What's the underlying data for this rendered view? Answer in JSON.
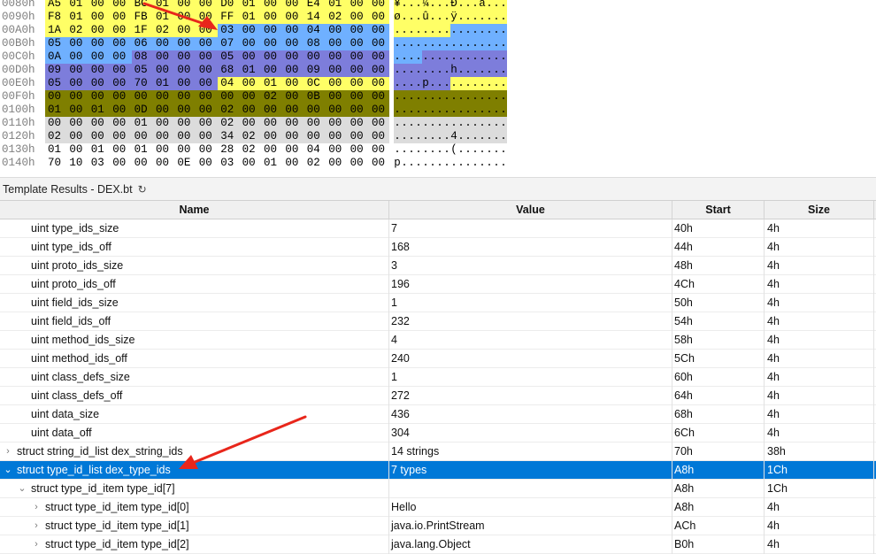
{
  "hex": {
    "colors": {
      "yellow": "#ffff66",
      "blue": "#6fb0ff",
      "purple": "#7d7ddb",
      "olive": "#7f7f00",
      "gray": "#dcdcdc",
      "white": "#ffffff"
    },
    "rows": [
      {
        "addr": "0080h",
        "bytes": [
          "A5",
          "01",
          "00",
          "00",
          "BC",
          "01",
          "00",
          "00",
          "D0",
          "01",
          "00",
          "00",
          "E4",
          "01",
          "00",
          "00"
        ],
        "ascii": "¥...¼...Ð...ä...",
        "bg": [
          "yellow",
          "yellow",
          "yellow",
          "yellow",
          "yellow",
          "yellow",
          "yellow",
          "yellow",
          "yellow",
          "yellow",
          "yellow",
          "yellow",
          "yellow",
          "yellow",
          "yellow",
          "yellow"
        ]
      },
      {
        "addr": "0090h",
        "bytes": [
          "F8",
          "01",
          "00",
          "00",
          "FB",
          "01",
          "00",
          "00",
          "FF",
          "01",
          "00",
          "00",
          "14",
          "02",
          "00",
          "00"
        ],
        "ascii": "ø...û...ÿ.......",
        "bg": [
          "yellow",
          "yellow",
          "yellow",
          "yellow",
          "yellow",
          "yellow",
          "yellow",
          "yellow",
          "yellow",
          "yellow",
          "yellow",
          "yellow",
          "yellow",
          "yellow",
          "yellow",
          "yellow"
        ]
      },
      {
        "addr": "00A0h",
        "bytes": [
          "1A",
          "02",
          "00",
          "00",
          "1F",
          "02",
          "00",
          "00",
          "03",
          "00",
          "00",
          "00",
          "04",
          "00",
          "00",
          "00"
        ],
        "ascii": "................",
        "bg": [
          "yellow",
          "yellow",
          "yellow",
          "yellow",
          "yellow",
          "yellow",
          "yellow",
          "yellow",
          "blue",
          "blue",
          "blue",
          "blue",
          "blue",
          "blue",
          "blue",
          "blue"
        ]
      },
      {
        "addr": "00B0h",
        "bytes": [
          "05",
          "00",
          "00",
          "00",
          "06",
          "00",
          "00",
          "00",
          "07",
          "00",
          "00",
          "00",
          "08",
          "00",
          "00",
          "00"
        ],
        "ascii": "................",
        "bg": [
          "blue",
          "blue",
          "blue",
          "blue",
          "blue",
          "blue",
          "blue",
          "blue",
          "blue",
          "blue",
          "blue",
          "blue",
          "blue",
          "blue",
          "blue",
          "blue"
        ]
      },
      {
        "addr": "00C0h",
        "bytes": [
          "0A",
          "00",
          "00",
          "00",
          "08",
          "00",
          "00",
          "00",
          "05",
          "00",
          "00",
          "00",
          "00",
          "00",
          "00",
          "00"
        ],
        "ascii": "................",
        "bg": [
          "blue",
          "blue",
          "blue",
          "blue",
          "purple",
          "purple",
          "purple",
          "purple",
          "purple",
          "purple",
          "purple",
          "purple",
          "purple",
          "purple",
          "purple",
          "purple"
        ]
      },
      {
        "addr": "00D0h",
        "bytes": [
          "09",
          "00",
          "00",
          "00",
          "05",
          "00",
          "00",
          "00",
          "68",
          "01",
          "00",
          "00",
          "09",
          "00",
          "00",
          "00"
        ],
        "ascii": "........h.......",
        "bg": [
          "purple",
          "purple",
          "purple",
          "purple",
          "purple",
          "purple",
          "purple",
          "purple",
          "purple",
          "purple",
          "purple",
          "purple",
          "purple",
          "purple",
          "purple",
          "purple"
        ]
      },
      {
        "addr": "00E0h",
        "bytes": [
          "05",
          "00",
          "00",
          "00",
          "70",
          "01",
          "00",
          "00",
          "04",
          "00",
          "01",
          "00",
          "0C",
          "00",
          "00",
          "00"
        ],
        "ascii": "....p...........",
        "bg": [
          "purple",
          "purple",
          "purple",
          "purple",
          "purple",
          "purple",
          "purple",
          "purple",
          "yellow",
          "yellow",
          "yellow",
          "yellow",
          "yellow",
          "yellow",
          "yellow",
          "yellow"
        ]
      },
      {
        "addr": "00F0h",
        "bytes": [
          "00",
          "00",
          "00",
          "00",
          "00",
          "00",
          "00",
          "00",
          "00",
          "00",
          "02",
          "00",
          "0B",
          "00",
          "00",
          "00"
        ],
        "ascii": "................",
        "bg": [
          "olive",
          "olive",
          "olive",
          "olive",
          "olive",
          "olive",
          "olive",
          "olive",
          "olive",
          "olive",
          "olive",
          "olive",
          "olive",
          "olive",
          "olive",
          "olive"
        ]
      },
      {
        "addr": "0100h",
        "bytes": [
          "01",
          "00",
          "01",
          "00",
          "0D",
          "00",
          "00",
          "00",
          "02",
          "00",
          "00",
          "00",
          "00",
          "00",
          "00",
          "00"
        ],
        "ascii": "................",
        "bg": [
          "olive",
          "olive",
          "olive",
          "olive",
          "olive",
          "olive",
          "olive",
          "olive",
          "olive",
          "olive",
          "olive",
          "olive",
          "olive",
          "olive",
          "olive",
          "olive"
        ]
      },
      {
        "addr": "0110h",
        "bytes": [
          "00",
          "00",
          "00",
          "00",
          "01",
          "00",
          "00",
          "00",
          "02",
          "00",
          "00",
          "00",
          "00",
          "00",
          "00",
          "00"
        ],
        "ascii": "................",
        "bg": [
          "gray",
          "gray",
          "gray",
          "gray",
          "gray",
          "gray",
          "gray",
          "gray",
          "gray",
          "gray",
          "gray",
          "gray",
          "gray",
          "gray",
          "gray",
          "gray"
        ]
      },
      {
        "addr": "0120h",
        "bytes": [
          "02",
          "00",
          "00",
          "00",
          "00",
          "00",
          "00",
          "00",
          "34",
          "02",
          "00",
          "00",
          "00",
          "00",
          "00",
          "00"
        ],
        "ascii": "........4.......",
        "bg": [
          "gray",
          "gray",
          "gray",
          "gray",
          "gray",
          "gray",
          "gray",
          "gray",
          "gray",
          "gray",
          "gray",
          "gray",
          "gray",
          "gray",
          "gray",
          "gray"
        ]
      },
      {
        "addr": "0130h",
        "bytes": [
          "01",
          "00",
          "01",
          "00",
          "01",
          "00",
          "00",
          "00",
          "28",
          "02",
          "00",
          "00",
          "04",
          "00",
          "00",
          "00"
        ],
        "ascii": "........(.......",
        "bg": [
          "white",
          "white",
          "white",
          "white",
          "white",
          "white",
          "white",
          "white",
          "white",
          "white",
          "white",
          "white",
          "white",
          "white",
          "white",
          "white"
        ]
      },
      {
        "addr": "0140h",
        "bytes": [
          "70",
          "10",
          "03",
          "00",
          "00",
          "00",
          "0E",
          "00",
          "03",
          "00",
          "01",
          "00",
          "02",
          "00",
          "00",
          "00"
        ],
        "ascii": "p...............",
        "bg": [
          "white",
          "white",
          "white",
          "white",
          "white",
          "white",
          "white",
          "white",
          "white",
          "white",
          "white",
          "white",
          "white",
          "white",
          "white",
          "white"
        ]
      }
    ]
  },
  "template_results": {
    "title": "Template Results - DEX.bt",
    "refresh_icon": "refresh-icon",
    "columns": {
      "name": "Name",
      "value": "Value",
      "start": "Start",
      "size": "Size"
    },
    "rows": [
      {
        "name": "uint type_ids_size",
        "value": "7",
        "start": "40h",
        "size": "4h",
        "indent": 2,
        "expander": "",
        "selected": false
      },
      {
        "name": "uint type_ids_off",
        "value": "168",
        "start": "44h",
        "size": "4h",
        "indent": 2,
        "expander": "",
        "selected": false
      },
      {
        "name": "uint proto_ids_size",
        "value": "3",
        "start": "48h",
        "size": "4h",
        "indent": 2,
        "expander": "",
        "selected": false
      },
      {
        "name": "uint proto_ids_off",
        "value": "196",
        "start": "4Ch",
        "size": "4h",
        "indent": 2,
        "expander": "",
        "selected": false
      },
      {
        "name": "uint field_ids_size",
        "value": "1",
        "start": "50h",
        "size": "4h",
        "indent": 2,
        "expander": "",
        "selected": false
      },
      {
        "name": "uint field_ids_off",
        "value": "232",
        "start": "54h",
        "size": "4h",
        "indent": 2,
        "expander": "",
        "selected": false
      },
      {
        "name": "uint method_ids_size",
        "value": "4",
        "start": "58h",
        "size": "4h",
        "indent": 2,
        "expander": "",
        "selected": false
      },
      {
        "name": "uint method_ids_off",
        "value": "240",
        "start": "5Ch",
        "size": "4h",
        "indent": 2,
        "expander": "",
        "selected": false
      },
      {
        "name": "uint class_defs_size",
        "value": "1",
        "start": "60h",
        "size": "4h",
        "indent": 2,
        "expander": "",
        "selected": false
      },
      {
        "name": "uint class_defs_off",
        "value": "272",
        "start": "64h",
        "size": "4h",
        "indent": 2,
        "expander": "",
        "selected": false
      },
      {
        "name": "uint data_size",
        "value": "436",
        "start": "68h",
        "size": "4h",
        "indent": 2,
        "expander": "",
        "selected": false
      },
      {
        "name": "uint data_off",
        "value": "304",
        "start": "6Ch",
        "size": "4h",
        "indent": 2,
        "expander": "",
        "selected": false
      },
      {
        "name": "struct string_id_list dex_string_ids",
        "value": "14 strings",
        "start": "70h",
        "size": "38h",
        "indent": 1,
        "expander": "›",
        "selected": false
      },
      {
        "name": "struct type_id_list dex_type_ids",
        "value": "7 types",
        "start": "A8h",
        "size": "1Ch",
        "indent": 1,
        "expander": "⌄",
        "selected": true
      },
      {
        "name": "struct type_id_item type_id[7]",
        "value": "",
        "start": "A8h",
        "size": "1Ch",
        "indent": 2,
        "expander": "⌄",
        "selected": false
      },
      {
        "name": "struct type_id_item type_id[0]",
        "value": "Hello",
        "start": "A8h",
        "size": "4h",
        "indent": 3,
        "expander": "›",
        "selected": false
      },
      {
        "name": "struct type_id_item type_id[1]",
        "value": "java.io.PrintStream",
        "start": "ACh",
        "size": "4h",
        "indent": 3,
        "expander": "›",
        "selected": false
      },
      {
        "name": "struct type_id_item type_id[2]",
        "value": "java.lang.Object",
        "start": "B0h",
        "size": "4h",
        "indent": 3,
        "expander": "›",
        "selected": false
      }
    ]
  },
  "annotation_color": "#e8261b"
}
